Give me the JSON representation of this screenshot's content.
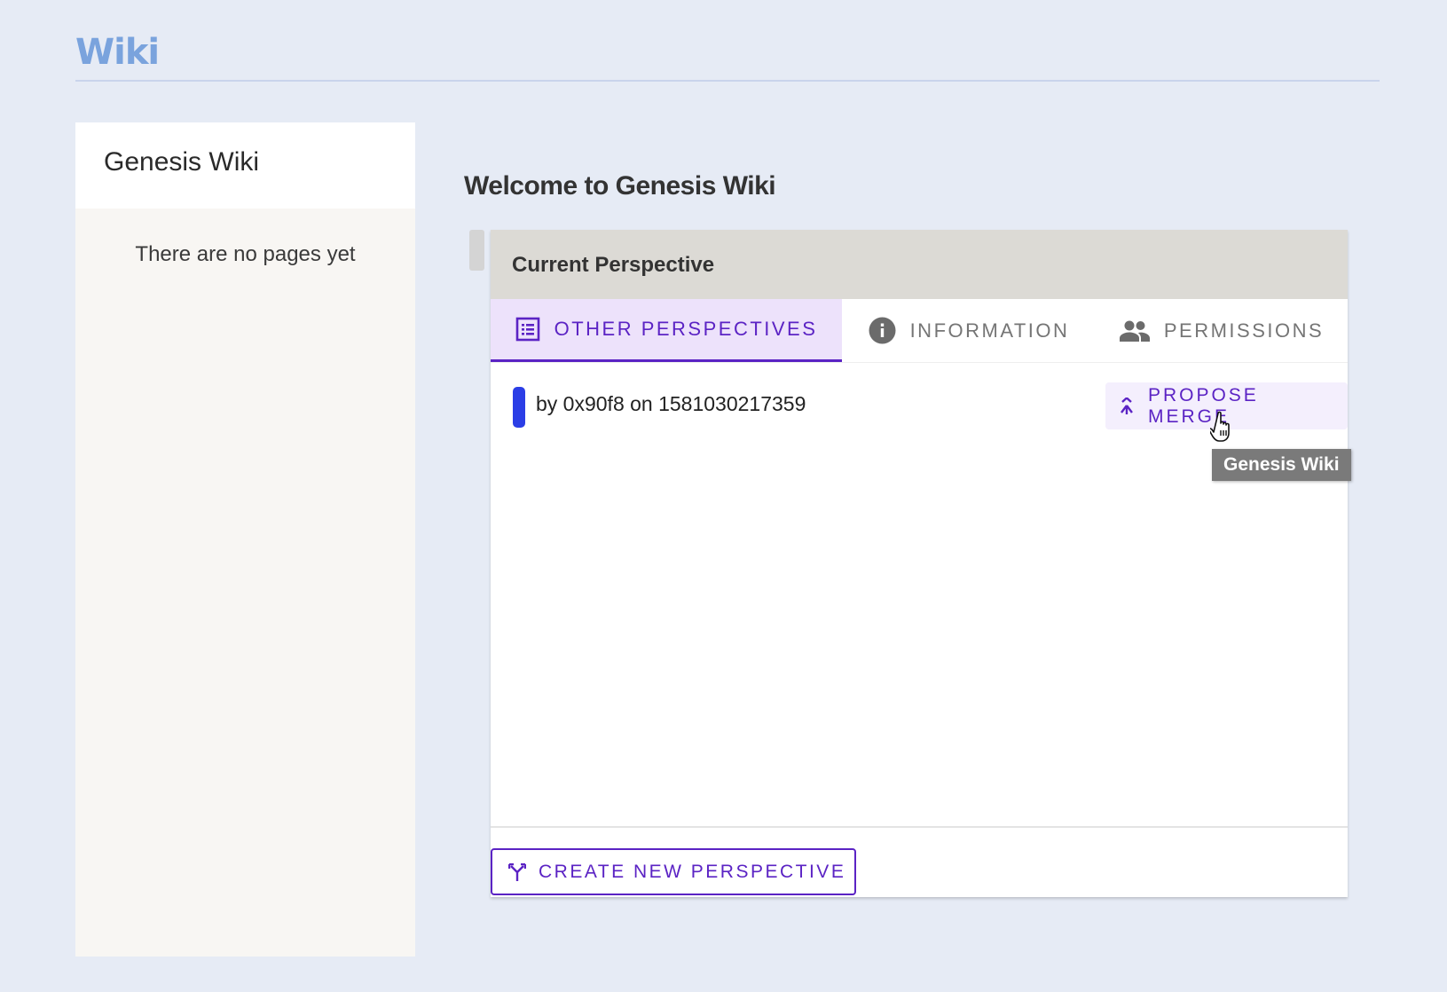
{
  "app": {
    "title": "Wiki"
  },
  "sidebar": {
    "title": "Genesis Wiki",
    "empty_message": "There are no pages yet"
  },
  "main": {
    "heading": "Welcome to Genesis Wiki",
    "panel": {
      "title": "Current Perspective",
      "tabs": [
        {
          "label": "OTHER PERSPECTIVES",
          "icon": "list-icon",
          "active": true
        },
        {
          "label": "INFORMATION",
          "icon": "info-icon",
          "active": false
        },
        {
          "label": "PERMISSIONS",
          "icon": "people-icon",
          "active": false
        }
      ],
      "perspectives": [
        {
          "text": "by 0x90f8 on 1581030217359",
          "color": "#2b3ee6"
        }
      ],
      "propose_merge_label": "PROPOSE MERGE",
      "create_label": "CREATE NEW PERSPECTIVE"
    },
    "tooltip": "Genesis Wiki"
  },
  "colors": {
    "accent": "#5b23c4",
    "app_title": "#7aa3dd",
    "background": "#e6ebf5"
  }
}
